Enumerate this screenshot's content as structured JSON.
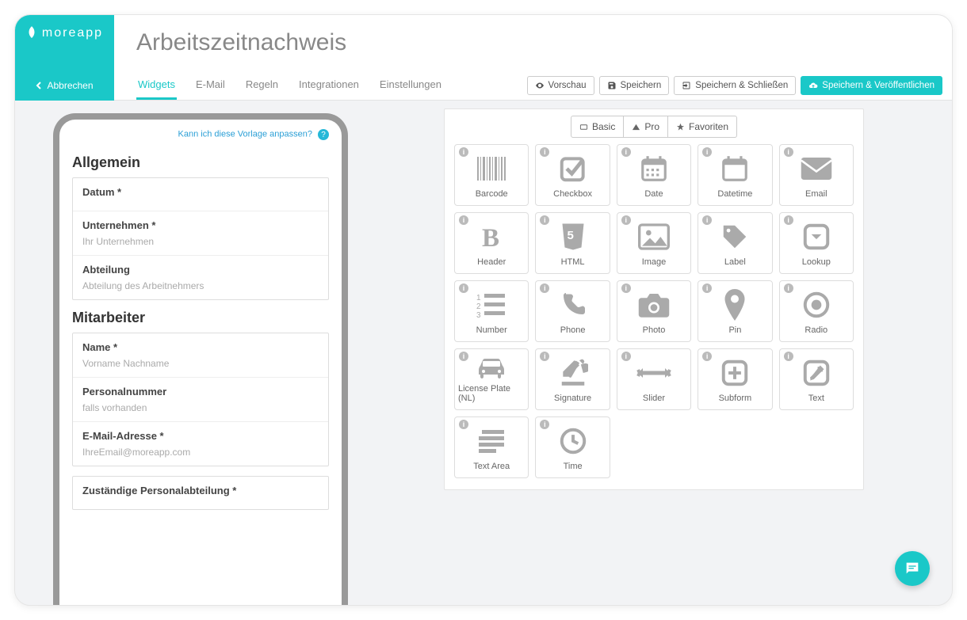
{
  "brand": "moreapp",
  "page_title": "Arbeitszeitnachweis",
  "cancel_label": "Abbrechen",
  "tabs": [
    "Widgets",
    "E-Mail",
    "Regeln",
    "Integrationen",
    "Einstellungen"
  ],
  "active_tab": 0,
  "actions": {
    "preview": "Vorschau",
    "save": "Speichern",
    "save_close": "Speichern & Schließen",
    "save_publish": "Speichern & Veröffentlichen"
  },
  "help_text": "Kann ich diese Vorlage anpassen?",
  "form": {
    "sections": [
      {
        "title": "Allgemein",
        "fields": [
          {
            "label": "Datum *",
            "placeholder": ""
          },
          {
            "label": "Unternehmen *",
            "placeholder": "Ihr Unternehmen"
          },
          {
            "label": "Abteilung",
            "placeholder": "Abteilung des Arbeitnehmers"
          }
        ]
      },
      {
        "title": "Mitarbeiter",
        "fields": [
          {
            "label": "Name *",
            "placeholder": "Vorname Nachname"
          },
          {
            "label": "Personalnummer",
            "placeholder": "falls vorhanden"
          },
          {
            "label": "E-Mail-Adresse *",
            "placeholder": "IhreEmail@moreapp.com"
          }
        ]
      },
      {
        "title": "",
        "fields": [
          {
            "label": "Zuständige Personalabteilung *",
            "placeholder": ""
          }
        ]
      }
    ]
  },
  "tiers": [
    "Basic",
    "Pro",
    "Favoriten"
  ],
  "widgets": [
    {
      "name": "Barcode",
      "icon": "barcode"
    },
    {
      "name": "Checkbox",
      "icon": "checkbox"
    },
    {
      "name": "Date",
      "icon": "date"
    },
    {
      "name": "Datetime",
      "icon": "datetime"
    },
    {
      "name": "Email",
      "icon": "email"
    },
    {
      "name": "Header",
      "icon": "header"
    },
    {
      "name": "HTML",
      "icon": "html"
    },
    {
      "name": "Image",
      "icon": "image"
    },
    {
      "name": "Label",
      "icon": "label"
    },
    {
      "name": "Lookup",
      "icon": "lookup"
    },
    {
      "name": "Number",
      "icon": "number"
    },
    {
      "name": "Phone",
      "icon": "phone"
    },
    {
      "name": "Photo",
      "icon": "photo"
    },
    {
      "name": "Pin",
      "icon": "pin"
    },
    {
      "name": "Radio",
      "icon": "radio"
    },
    {
      "name": "License Plate (NL)",
      "icon": "car"
    },
    {
      "name": "Signature",
      "icon": "signature"
    },
    {
      "name": "Slider",
      "icon": "slider"
    },
    {
      "name": "Subform",
      "icon": "subform"
    },
    {
      "name": "Text",
      "icon": "text"
    },
    {
      "name": "Text Area",
      "icon": "textarea"
    },
    {
      "name": "Time",
      "icon": "time"
    }
  ]
}
